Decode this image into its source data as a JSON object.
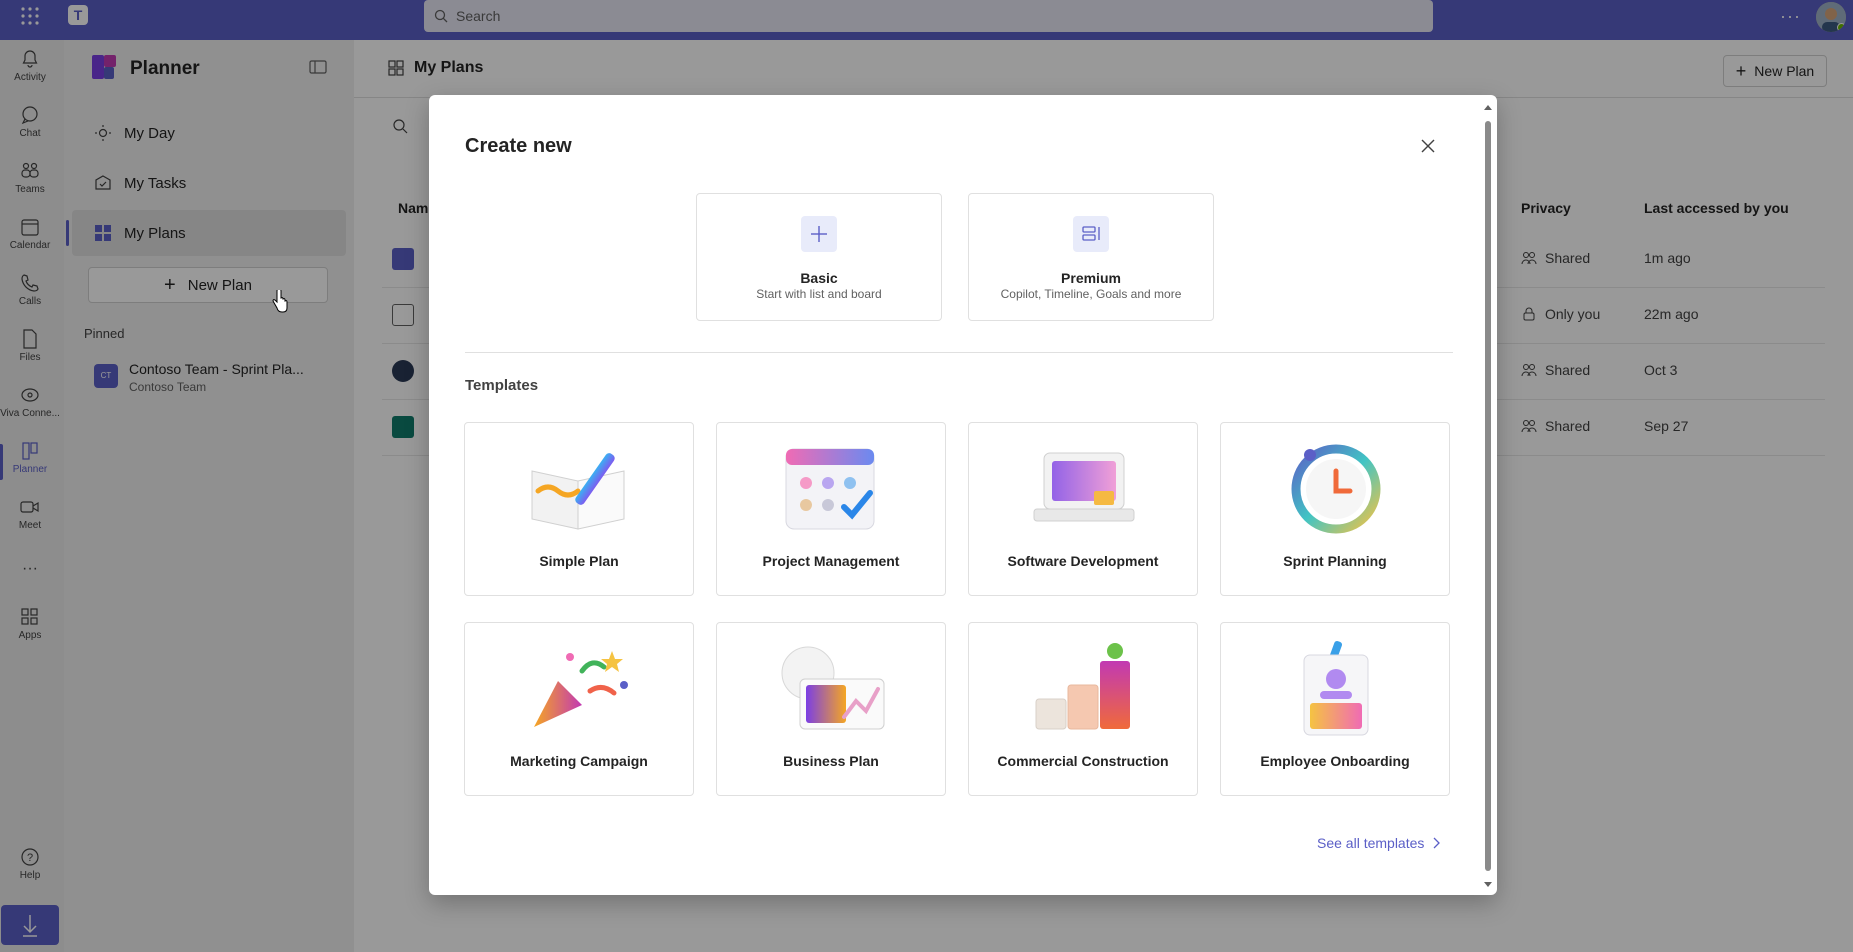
{
  "topbar": {
    "search_placeholder": "Search",
    "more": "···"
  },
  "rail": {
    "items": [
      {
        "label": "Activity",
        "icon": "bell-icon"
      },
      {
        "label": "Chat",
        "icon": "chat-icon"
      },
      {
        "label": "Teams",
        "icon": "teams-icon"
      },
      {
        "label": "Calendar",
        "icon": "calendar-icon"
      },
      {
        "label": "Calls",
        "icon": "phone-icon"
      },
      {
        "label": "Files",
        "icon": "file-icon"
      },
      {
        "label": "Viva Conne...",
        "icon": "viva-icon"
      },
      {
        "label": "Planner",
        "icon": "planner-icon"
      },
      {
        "label": "Meet",
        "icon": "video-icon"
      },
      {
        "label": "Apps",
        "icon": "apps-icon"
      },
      {
        "label": "Help",
        "icon": "help-icon"
      }
    ],
    "more": "···"
  },
  "sidebar": {
    "title": "Planner",
    "nav": [
      {
        "label": "My Day",
        "icon": "sun-icon"
      },
      {
        "label": "My Tasks",
        "icon": "tasks-icon"
      },
      {
        "label": "My Plans",
        "icon": "grid-icon"
      }
    ],
    "new_plan": "New Plan",
    "pinned_label": "Pinned",
    "pinned_item": {
      "initials": "CT",
      "name": "Contoso Team - Sprint Pla...",
      "team": "Contoso Team"
    }
  },
  "main": {
    "title": "My Plans",
    "new_plan": "New Plan",
    "columns": {
      "name": "Nam",
      "privacy": "Privacy",
      "accessed": "Last accessed by you"
    },
    "rows": [
      {
        "privacy": "Shared",
        "accessed": "1m ago",
        "color": "#5b5fc7"
      },
      {
        "privacy": "Only you",
        "accessed": "22m ago",
        "color": "#ffffff"
      },
      {
        "privacy": "Shared",
        "accessed": "Oct 3",
        "color": "#2b3a55"
      },
      {
        "privacy": "Shared",
        "accessed": "Sep 27",
        "color": "#107c6b"
      }
    ]
  },
  "dialog": {
    "title": "Create new",
    "basic": {
      "title": "Basic",
      "subtitle": "Start with list and board"
    },
    "premium": {
      "title": "Premium",
      "subtitle": "Copilot, Timeline, Goals and more"
    },
    "templates_label": "Templates",
    "templates": [
      {
        "name": "Simple Plan"
      },
      {
        "name": "Project Management"
      },
      {
        "name": "Software Development"
      },
      {
        "name": "Sprint Planning"
      },
      {
        "name": "Marketing Campaign"
      },
      {
        "name": "Business Plan"
      },
      {
        "name": "Commercial Construction"
      },
      {
        "name": "Employee Onboarding"
      }
    ],
    "see_all": "See all templates"
  },
  "colors": {
    "accent": "#5b5fc7",
    "topbar": "#5b5fc7"
  }
}
